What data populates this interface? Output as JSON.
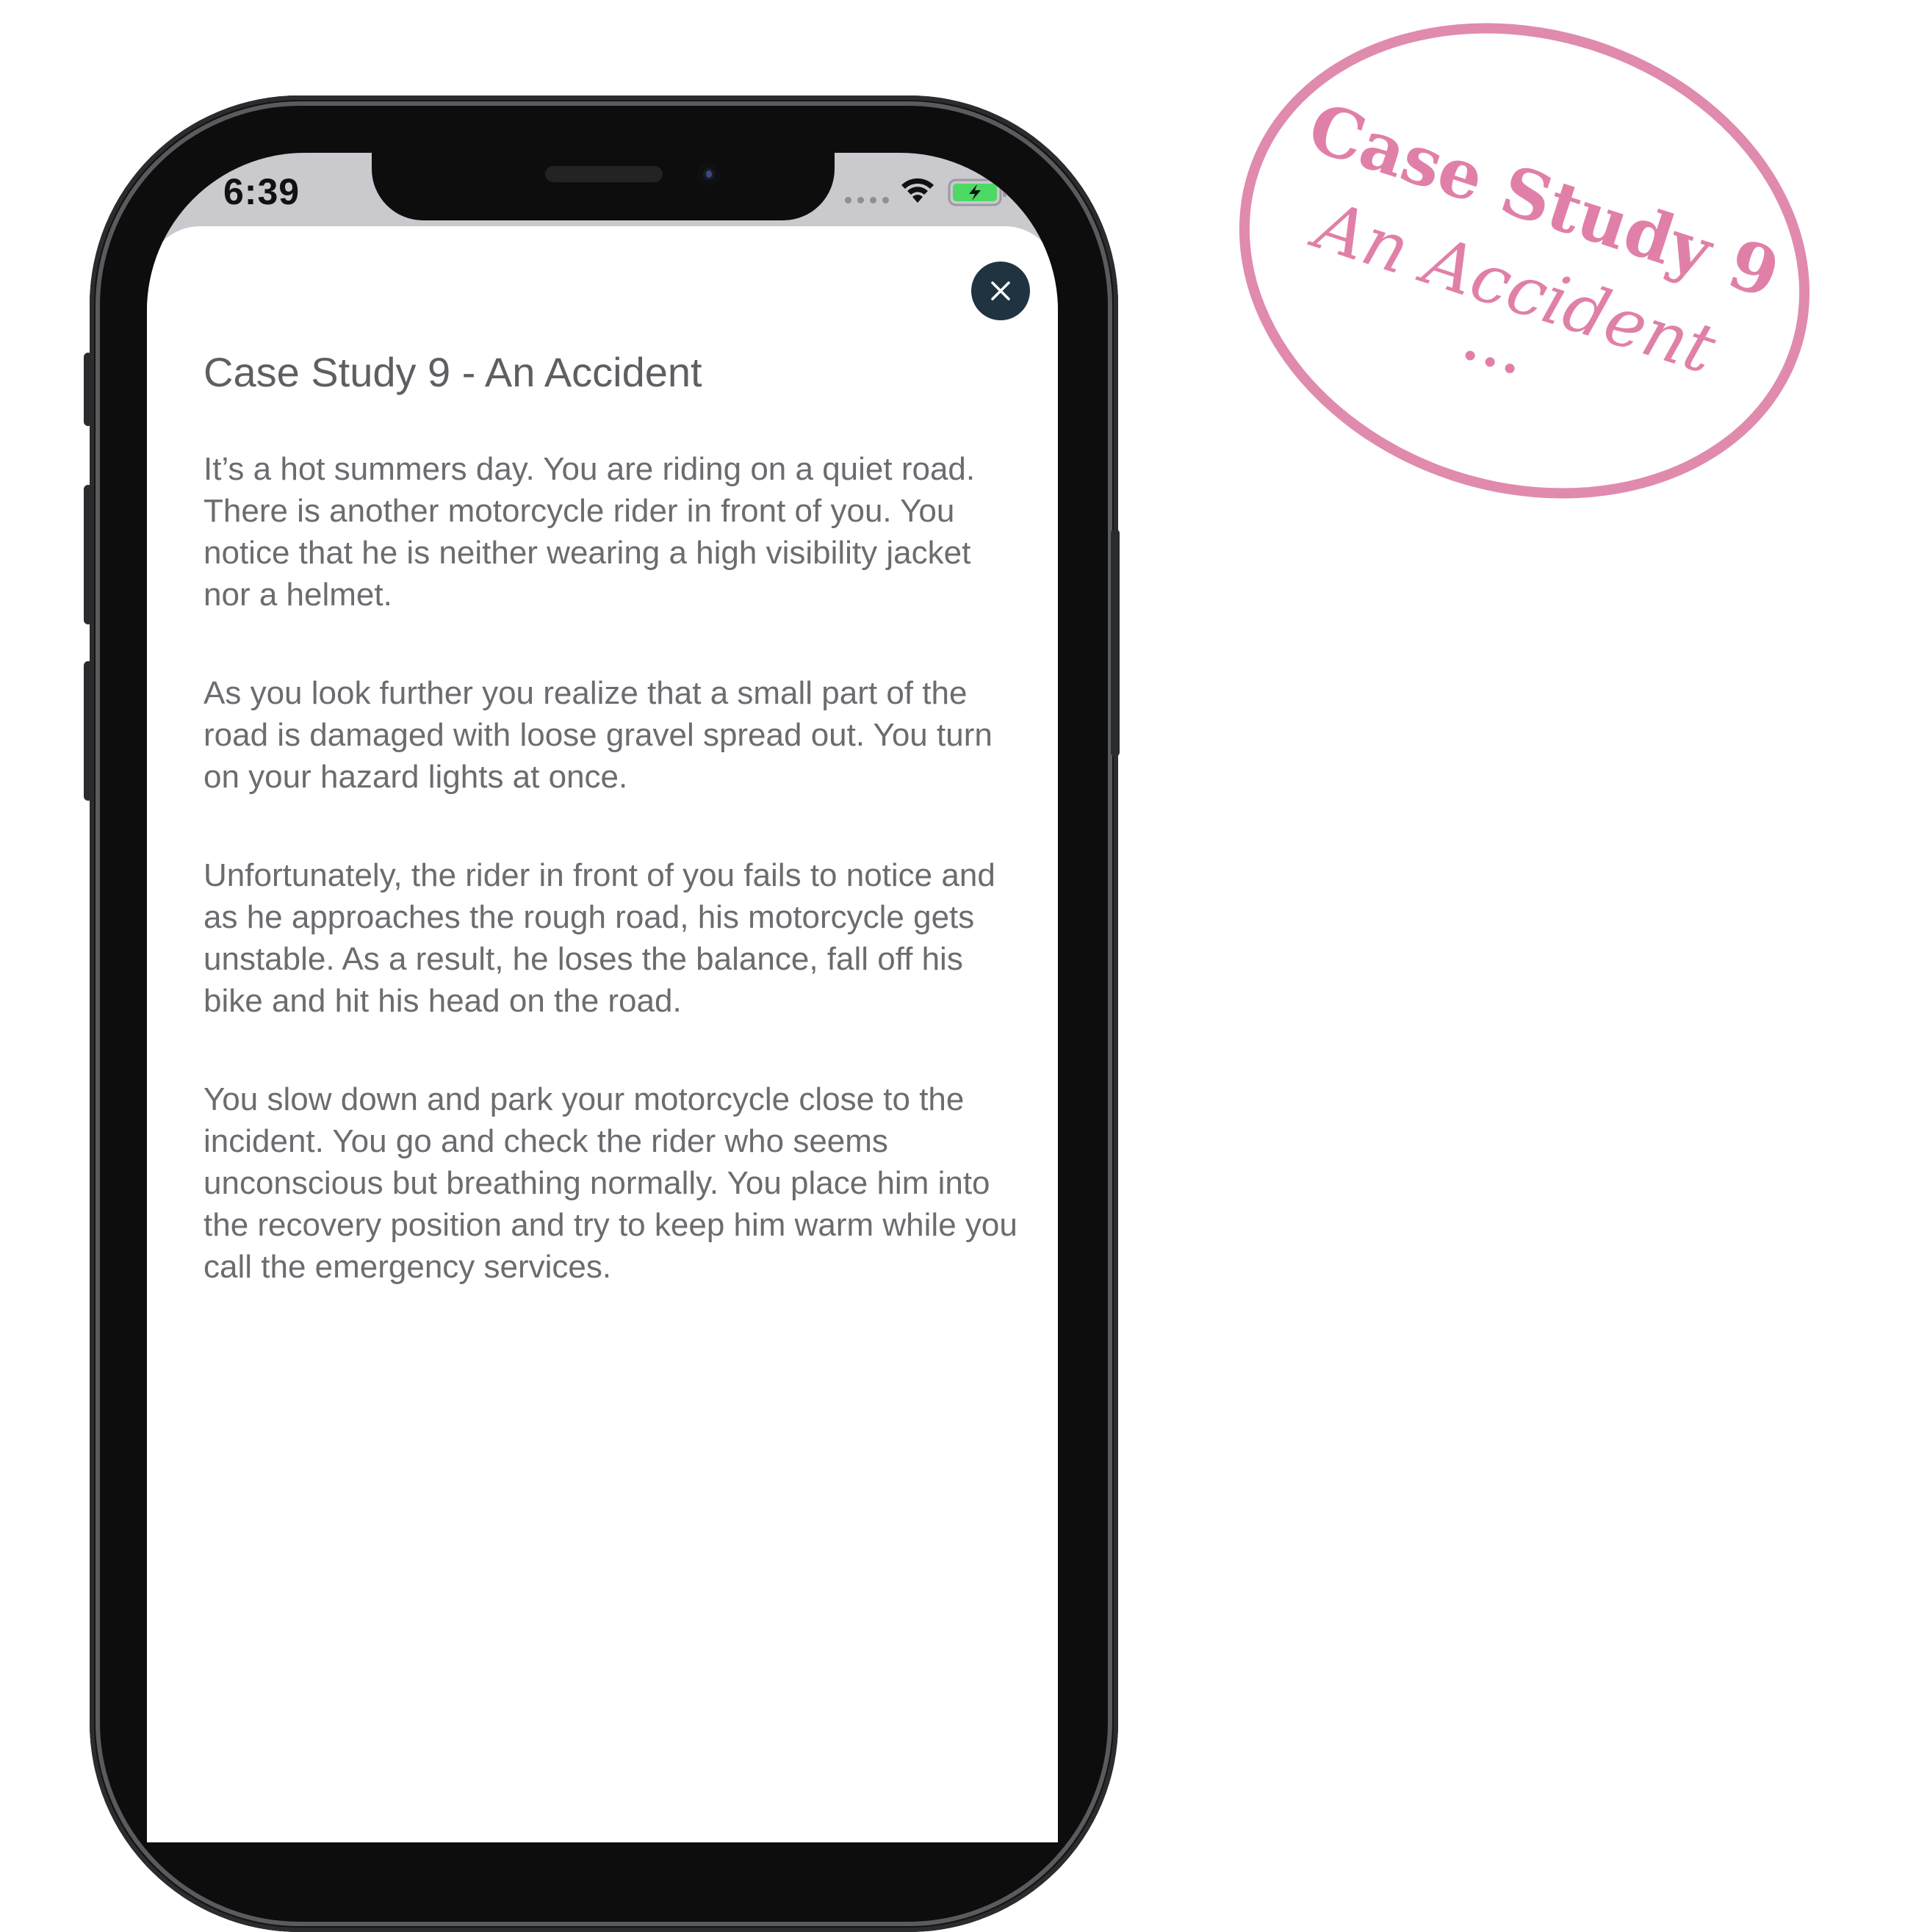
{
  "status_bar": {
    "time": "6:39",
    "icons": [
      "signal-dots-icon",
      "wifi-icon",
      "battery-charging-icon"
    ]
  },
  "sheet": {
    "close_icon": "close-icon",
    "title": "Case Study 9 - An Accident",
    "paragraphs": [
      "It’s a hot summers day. You are riding on a quiet road. There is another motorcycle rider in front of you. You notice that he is neither wearing a high visibility jacket nor a helmet.",
      "As you look further you realize that a small part of the road is damaged with loose gravel spread out. You turn on your hazard lights at once.",
      "Unfortunately, the rider in front of you fails to notice and as he approaches the rough road, his motorcycle gets unstable. As a result, he loses the balance, fall off his bike and hit his head on the road.",
      "You slow down and park your motorcycle close to the incident. You go and check the rider who seems unconscious but breathing normally. You place him into the recovery position and try to keep him warm while you call the emergency services."
    ]
  },
  "stamp": {
    "line1": "Case Study 9",
    "line2": "An Accident",
    "line3": "..."
  },
  "colors": {
    "stamp_pink": "#e08aae",
    "close_button": "#1f3341",
    "battery_green": "#4cd964",
    "body_text": "#6c6c70"
  }
}
